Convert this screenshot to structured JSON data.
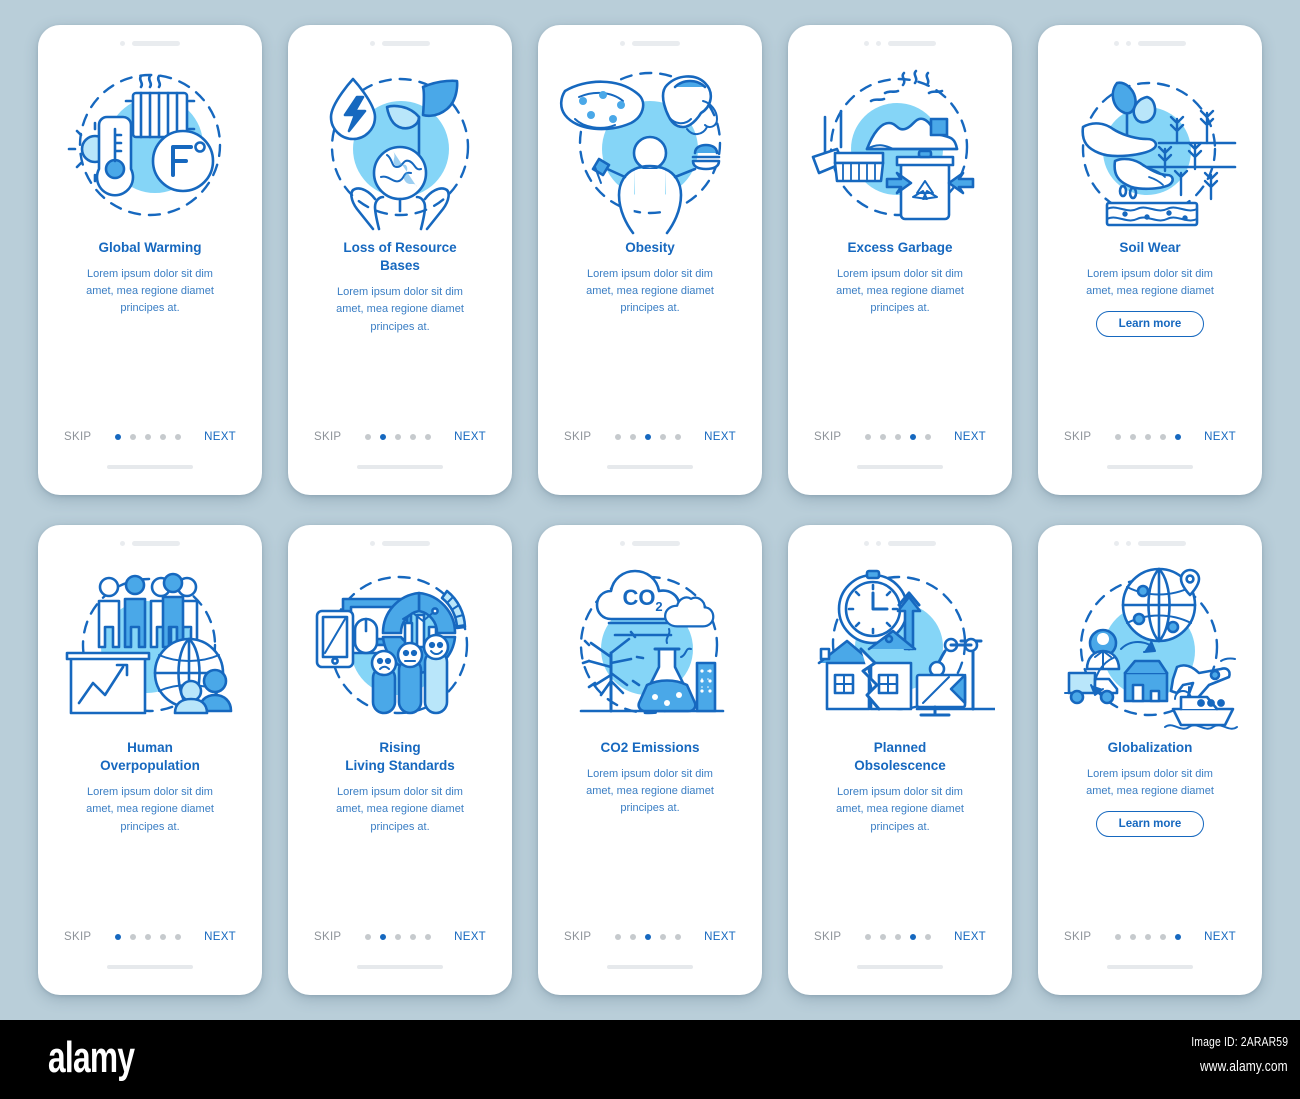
{
  "theme": {
    "background": "#b9ced9",
    "card_background": "#ffffff",
    "title_color": "#1668bf",
    "body_color": "#3a7ec4",
    "accent": "#1668bf",
    "icon_circle": "#85d5f7",
    "inactive_dot": "#c6cacd",
    "skip_color": "#8e9399"
  },
  "common": {
    "skip_label": "SKIP",
    "next_label": "NEXT",
    "learn_more_label": "Learn more",
    "body_text_3line": "Lorem ipsum dolor sit dim\namet, mea regione diamet\nprincipes at.",
    "body_text_2line": "Lorem ipsum dolor sit dim\namet, mea regione diamet",
    "dot_count": 5
  },
  "screens": [
    {
      "id": "global-warming",
      "title": "Global Warming",
      "body": "Lorem ipsum dolor sit dim\namet, mea regione diamet\nprincipes at.",
      "icon": "radiator-thermometer-fahrenheit-icon",
      "active_dot": 0,
      "has_learn_more": false,
      "camera_dots": 1
    },
    {
      "id": "loss-of-resource-bases",
      "title": "Loss of Resource\nBases",
      "body": "Lorem ipsum dolor sit dim\namet, mea regione diamet\nprincipes at.",
      "icon": "water-drop-leaf-earth-hands-icon",
      "active_dot": 1,
      "has_learn_more": false,
      "camera_dots": 1
    },
    {
      "id": "obesity",
      "title": "Obesity",
      "body": "Lorem ipsum dolor sit dim\namet, mea regione diamet\nprincipes at.",
      "icon": "pizza-icecream-person-burger-icon",
      "active_dot": 2,
      "has_learn_more": false,
      "camera_dots": 1
    },
    {
      "id": "excess-garbage",
      "title": "Excess Garbage",
      "body": "Lorem ipsum dolor sit dim\namet, mea regione diamet\nprincipes at.",
      "icon": "broom-trash-recycle-bin-icon",
      "active_dot": 3,
      "has_learn_more": false,
      "camera_dots": 2
    },
    {
      "id": "soil-wear",
      "title": "Soil Wear",
      "body": "Lorem ipsum dolor sit dim\namet, mea regione diamet",
      "icon": "hand-sprout-soil-crops-icon",
      "active_dot": 4,
      "has_learn_more": true,
      "camera_dots": 2
    },
    {
      "id": "human-overpopulation",
      "title": "Human\nOverpopulation",
      "body": "Lorem ipsum dolor sit dim\namet, mea regione diamet\nprincipes at.",
      "icon": "crowd-growth-chart-globe-icon",
      "active_dot": 0,
      "has_learn_more": false,
      "camera_dots": 1
    },
    {
      "id": "rising-living-standards",
      "title": "Rising\nLiving Standards",
      "body": "Lorem ipsum dolor sit dim\namet, mea regione diamet\nprincipes at.",
      "icon": "devices-dashboard-smiley-people-icon",
      "active_dot": 1,
      "has_learn_more": false,
      "camera_dots": 1
    },
    {
      "id": "co2-emissions",
      "title": "CO2 Emissions",
      "body": "Lorem ipsum dolor sit dim\namet, mea regione diamet\nprincipes at.",
      "icon": "co2-cloud-tree-flask-factory-icon",
      "active_dot": 2,
      "has_learn_more": false,
      "camera_dots": 1
    },
    {
      "id": "planned-obsolescence",
      "title": "Planned\nObsolescence",
      "body": "Lorem ipsum dolor sit dim\namet, mea regione diamet\nprincipes at.",
      "icon": "clock-broken-house-robot-arm-icon",
      "active_dot": 3,
      "has_learn_more": false,
      "camera_dots": 2
    },
    {
      "id": "globalization",
      "title": "Globalization",
      "body": "Lorem ipsum dolor sit dim\namet, mea regione diamet",
      "icon": "globe-truck-plane-ship-factory-icon",
      "active_dot": 4,
      "has_learn_more": true,
      "camera_dots": 2
    }
  ],
  "watermark": {
    "logo": "alamy",
    "image_id": "Image ID: 2ARAR59",
    "url": "www.alamy.com"
  }
}
